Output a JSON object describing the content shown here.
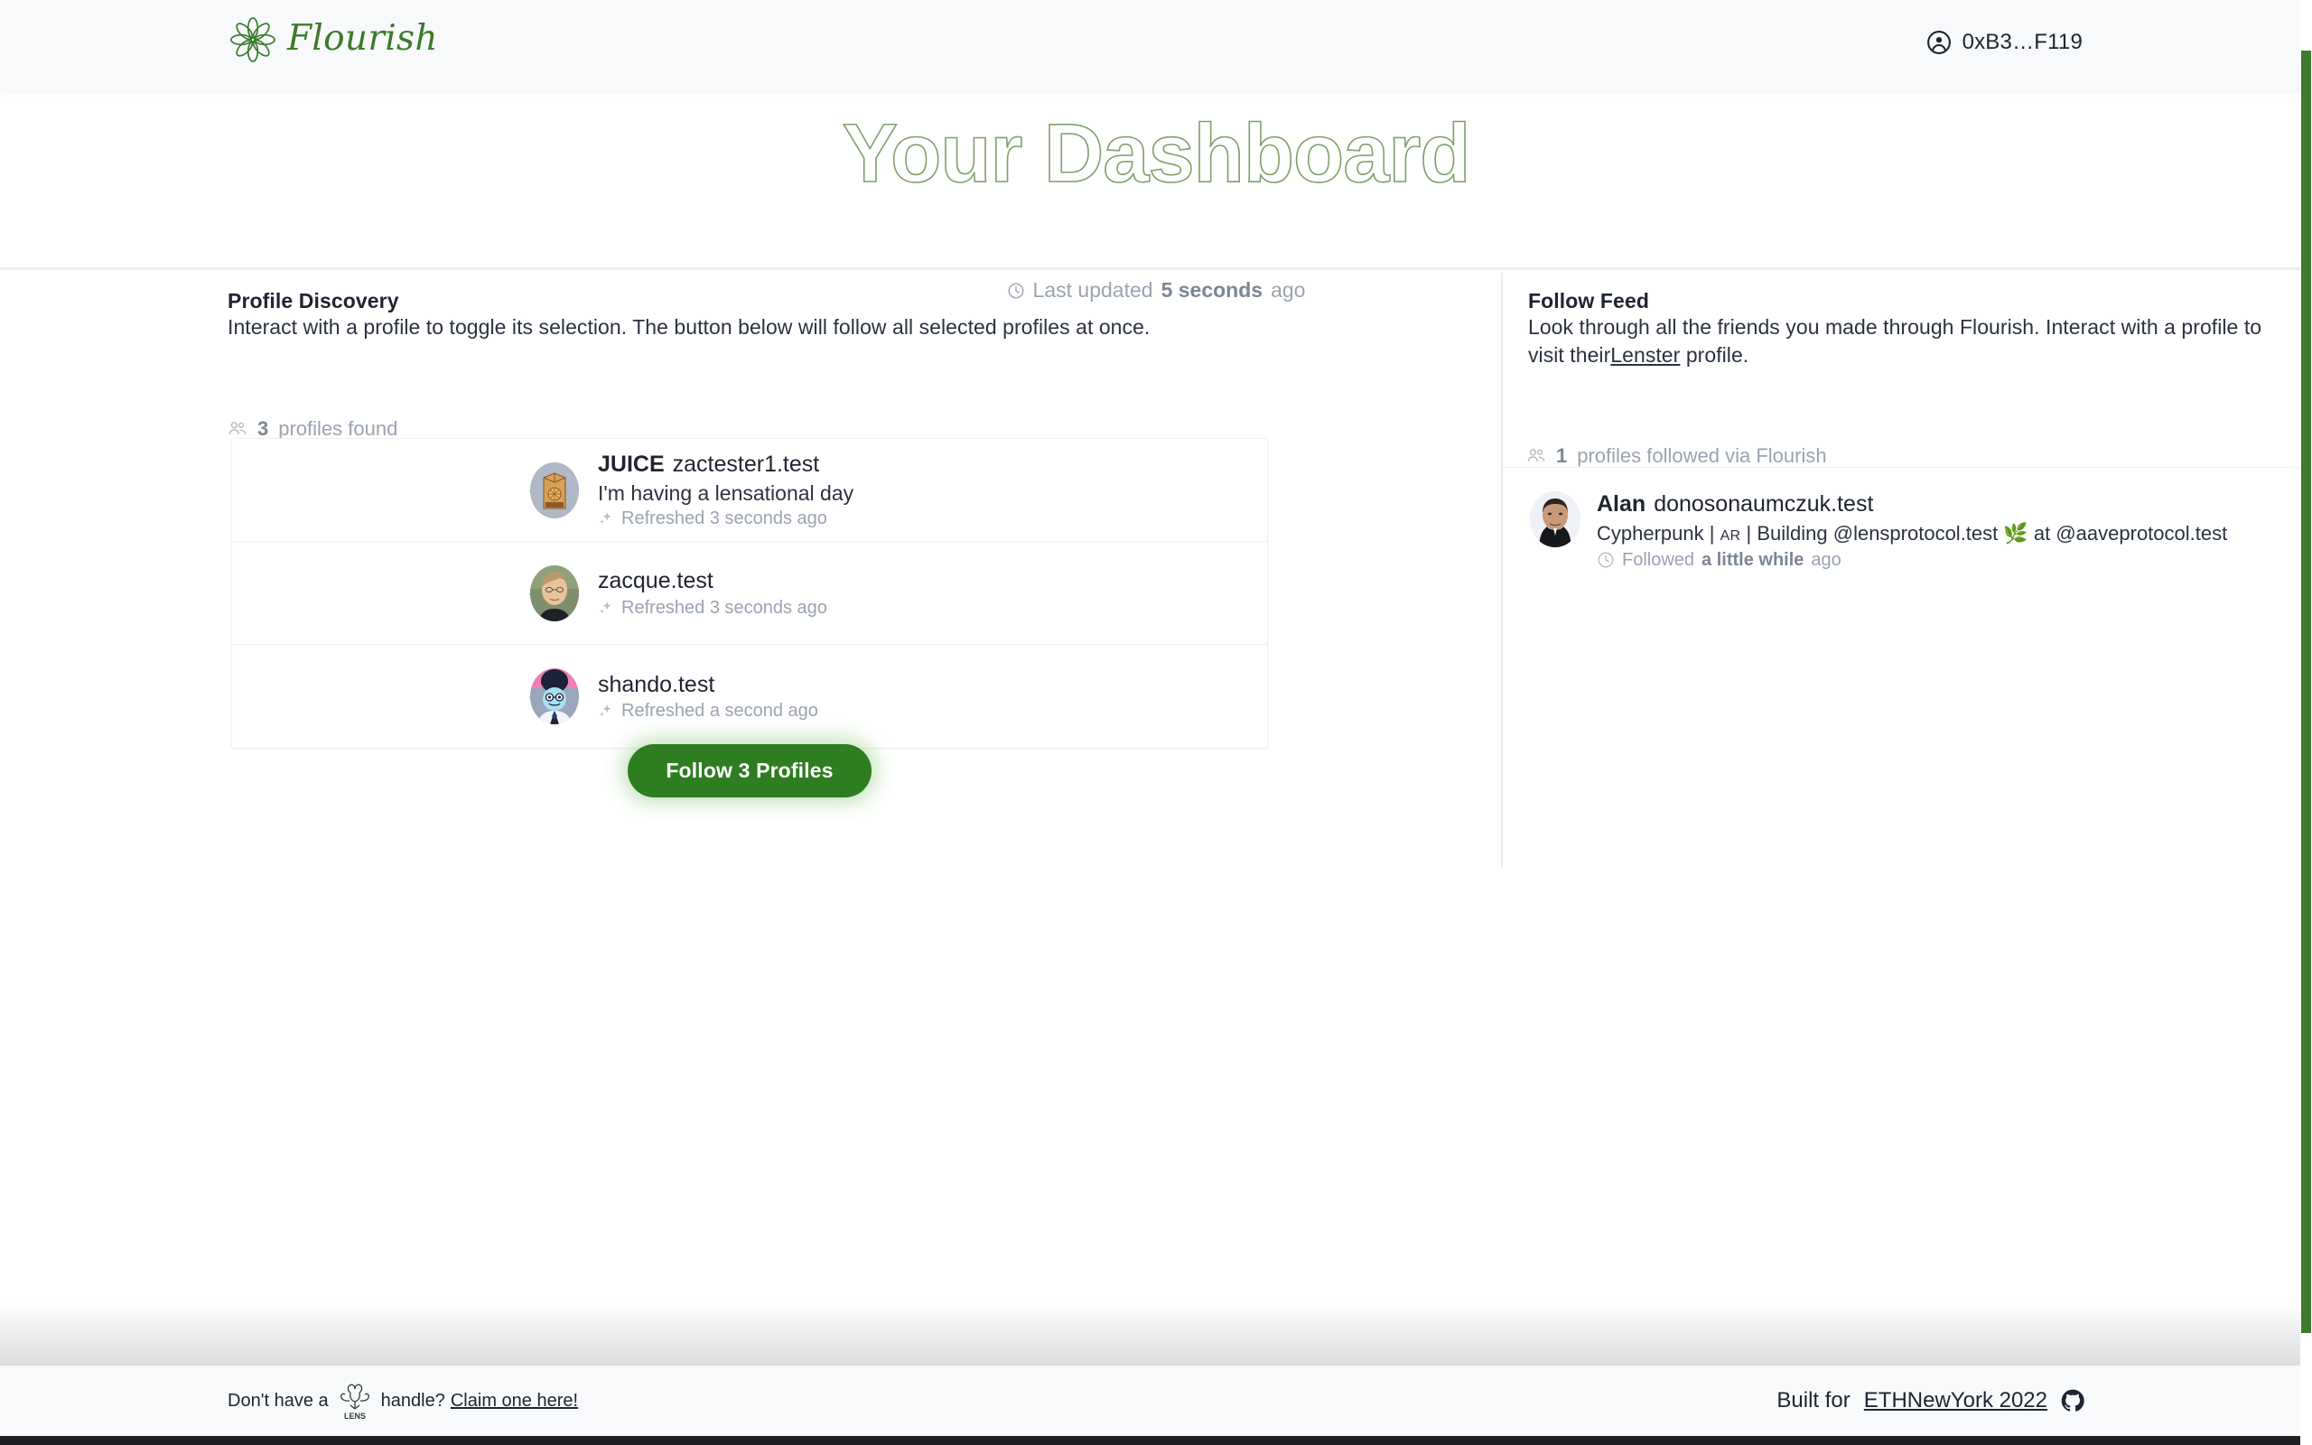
{
  "header": {
    "brand_name": "Flourish",
    "brand_icon": "flower-logo-icon",
    "wallet_icon": "account-circle-icon",
    "wallet_address": "0xB3…F119"
  },
  "hero": {
    "title": "Your Dashboard",
    "clock_icon": "clock-icon",
    "updated_prefix": "Last updated",
    "updated_value": "5 seconds",
    "updated_suffix": "ago"
  },
  "discovery": {
    "title": "Profile Discovery",
    "description": "Interact with a profile to toggle its selection. The button below will follow all selected profiles at once.",
    "users_icon": "users-icon",
    "count_value": "3",
    "count_label": "profiles found",
    "check_icon": "check-icon",
    "sparkle_icon": "sparkle-icon",
    "profiles": [
      {
        "selected": true,
        "display_name": "JUICE",
        "handle": "zactester1.test",
        "bio": "I'm having a lensational day",
        "refreshed": "Refreshed 3 seconds ago",
        "avatar": "juice-carton-avatar"
      },
      {
        "selected": true,
        "display_name": "",
        "handle": "zacque.test",
        "bio": "",
        "refreshed": "Refreshed 3 seconds ago",
        "avatar": "person-photo-avatar"
      },
      {
        "selected": true,
        "display_name": "",
        "handle": "shando.test",
        "bio": "",
        "refreshed": "Refreshed a second ago",
        "avatar": "cartoon-character-avatar"
      }
    ],
    "follow_button_label": "Follow 3 Profiles"
  },
  "feed": {
    "title": "Follow Feed",
    "description_part1": "Look through all the friends you made through Flourish. Interact with a profile to visit their",
    "description_link": "Lenster",
    "description_part2": " profile.",
    "users_icon": "users-icon",
    "count_value": "1",
    "count_label": "profiles followed via Flourish",
    "clock_icon": "clock-icon",
    "entries": [
      {
        "display_name": "Alan",
        "handle": "donosonaumczuk.test",
        "bio_pre": "Cypherpunk | ",
        "bio_smallcaps": "AR",
        "bio_post": " | Building @lensprotocol.test 🌿 at @aaveprotocol.test",
        "followed_prefix": "Followed",
        "followed_value": "a little while",
        "followed_suffix": "ago",
        "avatar": "man-photo-avatar"
      }
    ]
  },
  "footer": {
    "left_text_1": "Don't have a",
    "lens_icon": "lens-logo-icon",
    "left_text_2": "handle?",
    "left_link": "Claim one here!",
    "right_text": "Built for",
    "right_link": "ETHNewYork 2022",
    "github_icon": "github-icon"
  },
  "colors": {
    "brand_green": "#3d7a2c",
    "button_green": "#2e7d21",
    "check_green": "#2e7d21",
    "title_stroke": "#7fa06b",
    "muted": "#9aa3b0",
    "text": "#1f2430",
    "header_bg": "#f8f9fb",
    "scrollbar": "#3d7a2c"
  }
}
